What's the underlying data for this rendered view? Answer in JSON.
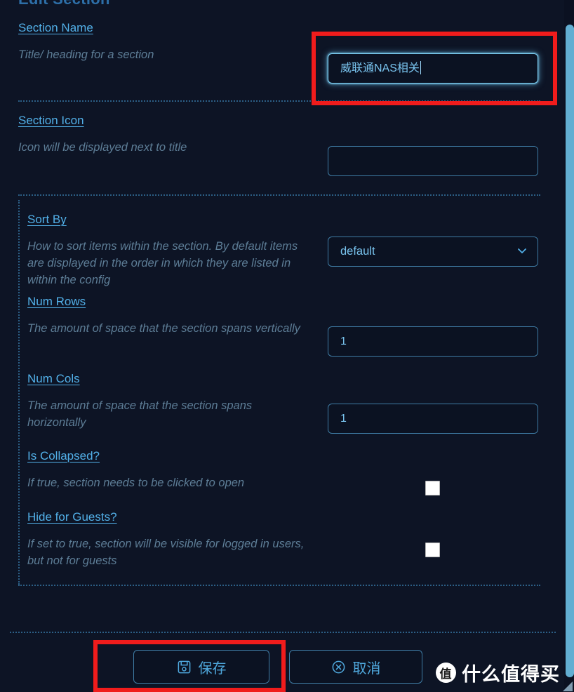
{
  "modal": {
    "heading": "Edit Section"
  },
  "fields": [
    {
      "label": "Section Name",
      "desc": "Title/ heading for a section",
      "value": "威联通NAS相关",
      "control": "text",
      "focused": true
    },
    {
      "label": "Section Icon",
      "desc": "Icon will be displayed next to title",
      "value": "",
      "control": "text",
      "focused": false
    },
    {
      "label": "Sort By",
      "desc": "How to sort items within the section. By default items are displayed in the order in which they are listed in within the config",
      "value": "default",
      "control": "select"
    },
    {
      "label": "Num Rows",
      "desc": "The amount of space that the section spans vertically",
      "value": "1",
      "control": "text",
      "focused": false
    },
    {
      "label": "Num Cols",
      "desc": "The amount of space that the section spans horizontally",
      "value": "1",
      "control": "text",
      "focused": false
    },
    {
      "label": "Is Collapsed?",
      "desc": "If true, section needs to be clicked to open",
      "value": "",
      "control": "checkbox",
      "checked": false
    },
    {
      "label": "Hide for Guests?",
      "desc": "If set to true, section will be visible for logged in users, but not for guests",
      "value": "",
      "control": "checkbox",
      "checked": false
    }
  ],
  "footer": {
    "save_label": "保存",
    "save_icon": "save-floppy-icon",
    "cancel_label": "取消",
    "cancel_icon": "circle-x-icon"
  },
  "watermark": {
    "logo_char": "值",
    "text": "什么值得买"
  },
  "colors": {
    "background": "#0d1425",
    "accent": "#52b0e8",
    "border": "#3f7ca5",
    "desc_text": "#5d7d96",
    "highlight": "#f01c1c",
    "scrollbar": "#62aed2"
  }
}
